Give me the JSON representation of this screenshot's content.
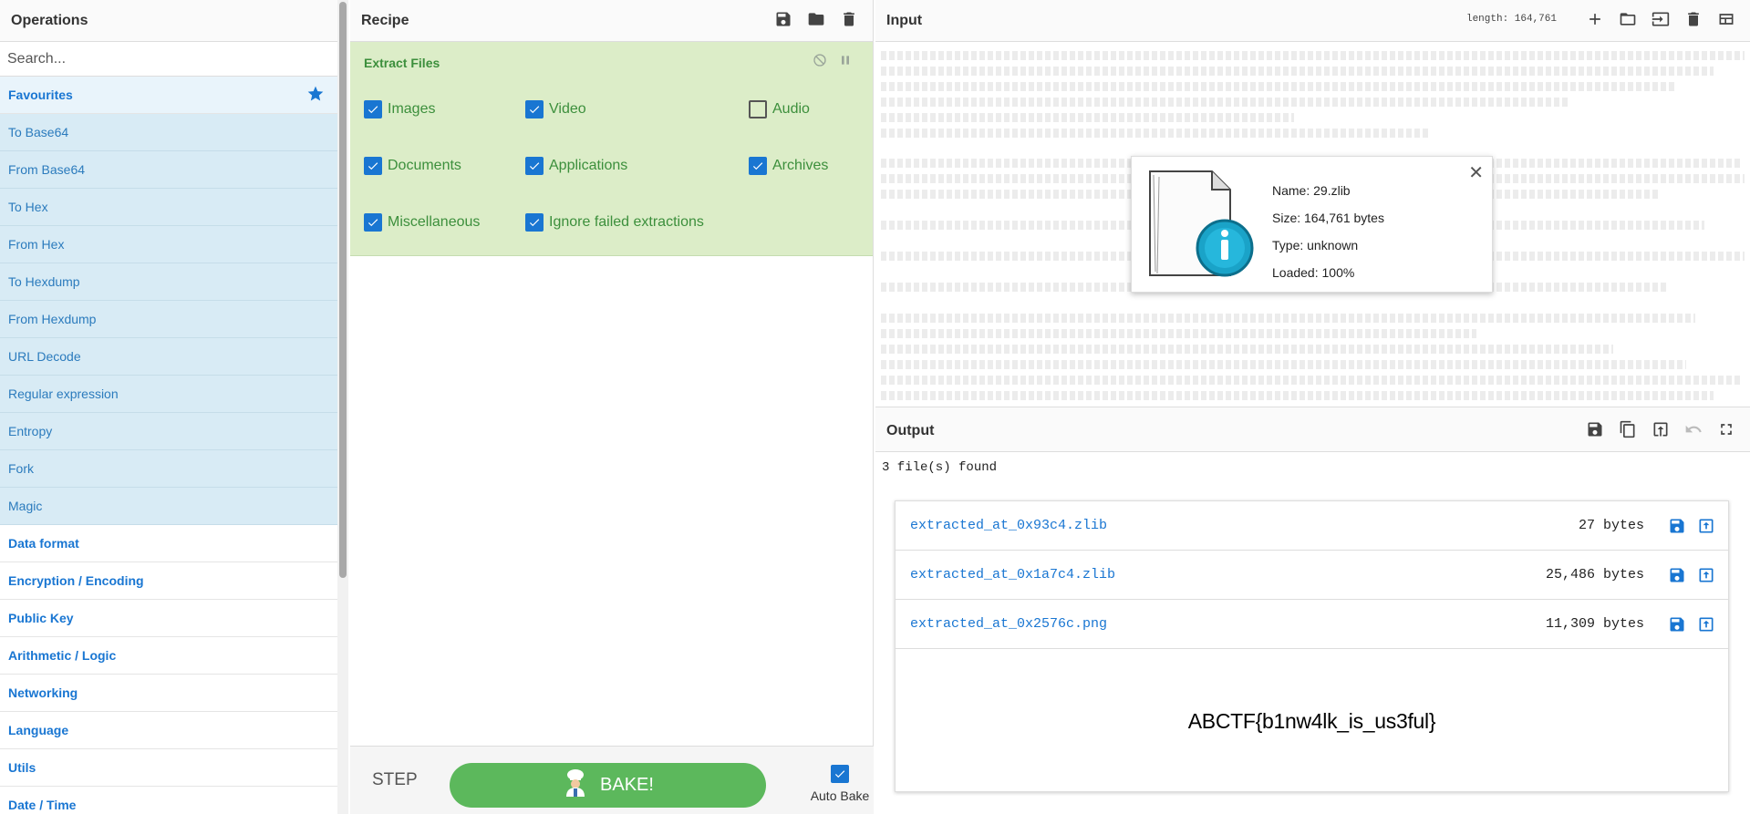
{
  "operations": {
    "title": "Operations",
    "search_placeholder": "Search...",
    "favourites_label": "Favourites",
    "favourites": [
      "To Base64",
      "From Base64",
      "To Hex",
      "From Hex",
      "To Hexdump",
      "From Hexdump",
      "URL Decode",
      "Regular expression",
      "Entropy",
      "Fork",
      "Magic"
    ],
    "categories": [
      "Data format",
      "Encryption / Encoding",
      "Public Key",
      "Arithmetic / Logic",
      "Networking",
      "Language",
      "Utils",
      "Date / Time"
    ]
  },
  "recipe": {
    "title": "Recipe",
    "operation": {
      "name": "Extract Files",
      "options": [
        {
          "label": "Images",
          "checked": true
        },
        {
          "label": "Video",
          "checked": true
        },
        {
          "label": "Audio",
          "checked": false
        },
        {
          "label": "Documents",
          "checked": true
        },
        {
          "label": "Applications",
          "checked": true
        },
        {
          "label": "Archives",
          "checked": true
        },
        {
          "label": "Miscellaneous",
          "checked": true
        },
        {
          "label": "Ignore failed extractions",
          "checked": true
        }
      ]
    },
    "step_label": "STEP",
    "bake_label": "BAKE!",
    "auto_bake_label": "Auto Bake",
    "auto_bake_checked": true
  },
  "input": {
    "title": "Input",
    "length_text": "length: 164,761",
    "file_info": {
      "name": "Name: 29.zlib",
      "size": "Size: 164,761 bytes",
      "type": "Type: unknown",
      "loaded": "Loaded: 100%"
    }
  },
  "output": {
    "title": "Output",
    "summary": "3 file(s) found",
    "files": [
      {
        "name": "extracted_at_0x93c4.zlib",
        "size": "27 bytes"
      },
      {
        "name": "extracted_at_0x1a7c4.zlib",
        "size": "25,486 bytes"
      },
      {
        "name": "extracted_at_0x2576c.png",
        "size": "11,309 bytes"
      }
    ],
    "preview_text": "ABCTF{b1nw4lk_is_us3ful}"
  },
  "colors": {
    "accent": "#1976d2",
    "recipe_bg": "#dcedc8",
    "bake_green": "#5cb85c",
    "favourite_bg": "#d8ebf5"
  }
}
